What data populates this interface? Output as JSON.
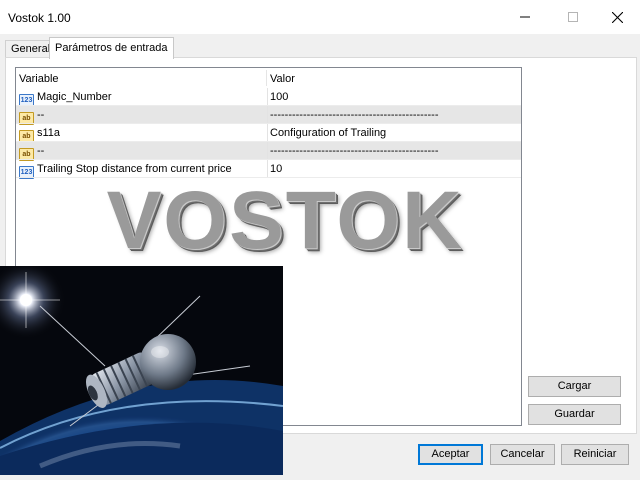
{
  "window": {
    "title": "Vostok 1.00"
  },
  "tabs": [
    {
      "label": "General"
    },
    {
      "label": "Parámetros de entrada"
    }
  ],
  "table": {
    "headers": {
      "variable": "Variable",
      "value": "Valor"
    },
    "rows": [
      {
        "icon": "number-type-icon",
        "icon_text": "123",
        "variable": "Magic_Number",
        "value": "100",
        "shaded": false
      },
      {
        "icon": "string-type-icon",
        "icon_text": "ab",
        "variable": "--",
        "value": "----------------------------------------------",
        "shaded": true
      },
      {
        "icon": "string-type-icon",
        "icon_text": "ab",
        "variable": "s11a",
        "value": "Configuration of Trailing",
        "shaded": false
      },
      {
        "icon": "string-type-icon",
        "icon_text": "ab",
        "variable": "--",
        "value": "----------------------------------------------",
        "shaded": true
      },
      {
        "icon": "number-type-icon",
        "icon_text": "123",
        "variable": "Trailing Stop distance from current price",
        "value": "10",
        "shaded": false
      }
    ]
  },
  "watermark": {
    "text": "VOSTOK"
  },
  "buttons": {
    "load": "Cargar",
    "save": "Guardar",
    "accept": "Aceptar",
    "cancel": "Cancelar",
    "reset": "Reiniciar"
  },
  "colors": {
    "accent": "#0078d7",
    "button_face": "#e1e1e1",
    "shaded_row": "#e6e6e6"
  }
}
